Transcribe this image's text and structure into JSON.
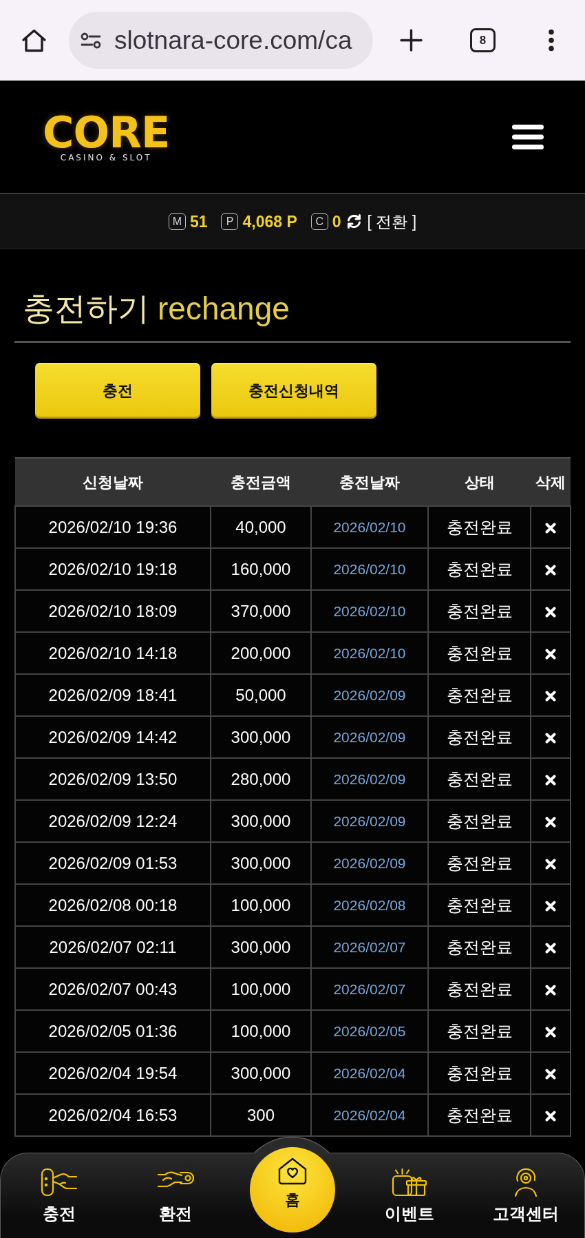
{
  "browser": {
    "url": "slotnara-core.com/ca",
    "tab_count": "8"
  },
  "header": {
    "logo": {
      "wordmark": "CORE",
      "tagline": "CASINO & SLOT"
    }
  },
  "balance": {
    "items": [
      {
        "mark": "M",
        "value": "51"
      },
      {
        "mark": "P",
        "value": "4,068 P"
      },
      {
        "mark": "C",
        "value": "0"
      }
    ],
    "convert_label": "[ 전환 ]"
  },
  "page": {
    "title": "충전하기",
    "subtitle": "rechange"
  },
  "actions": [
    {
      "label": "충전"
    },
    {
      "label": "충전신청내역"
    }
  ],
  "table": {
    "columns": [
      "신청날짜",
      "충전금액",
      "충전날짜",
      "상태",
      "삭제"
    ],
    "rows": [
      {
        "requested_at": "2026/02/10 19:36",
        "amount": "40,000",
        "charged_at": "2026/02/10",
        "status": "충전완료"
      },
      {
        "requested_at": "2026/02/10 19:18",
        "amount": "160,000",
        "charged_at": "2026/02/10",
        "status": "충전완료"
      },
      {
        "requested_at": "2026/02/10 18:09",
        "amount": "370,000",
        "charged_at": "2026/02/10",
        "status": "충전완료"
      },
      {
        "requested_at": "2026/02/10 14:18",
        "amount": "200,000",
        "charged_at": "2026/02/10",
        "status": "충전완료"
      },
      {
        "requested_at": "2026/02/09 18:41",
        "amount": "50,000",
        "charged_at": "2026/02/09",
        "status": "충전완료"
      },
      {
        "requested_at": "2026/02/09 14:42",
        "amount": "300,000",
        "charged_at": "2026/02/09",
        "status": "충전완료"
      },
      {
        "requested_at": "2026/02/09 13:50",
        "amount": "280,000",
        "charged_at": "2026/02/09",
        "status": "충전완료"
      },
      {
        "requested_at": "2026/02/09 12:24",
        "amount": "300,000",
        "charged_at": "2026/02/09",
        "status": "충전완료"
      },
      {
        "requested_at": "2026/02/09 01:53",
        "amount": "300,000",
        "charged_at": "2026/02/09",
        "status": "충전완료"
      },
      {
        "requested_at": "2026/02/08 00:18",
        "amount": "100,000",
        "charged_at": "2026/02/08",
        "status": "충전완료"
      },
      {
        "requested_at": "2026/02/07 02:11",
        "amount": "300,000",
        "charged_at": "2026/02/07",
        "status": "충전완료"
      },
      {
        "requested_at": "2026/02/07 00:43",
        "amount": "100,000",
        "charged_at": "2026/02/07",
        "status": "충전완료"
      },
      {
        "requested_at": "2026/02/05 01:36",
        "amount": "100,000",
        "charged_at": "2026/02/05",
        "status": "충전완료"
      },
      {
        "requested_at": "2026/02/04 19:54",
        "amount": "300,000",
        "charged_at": "2026/02/04",
        "status": "충전완료"
      },
      {
        "requested_at": "2026/02/04 16:53",
        "amount": "300",
        "charged_at": "2026/02/04",
        "status": "충전완료"
      }
    ]
  },
  "bottom_nav": [
    {
      "label": "충전",
      "kind": "tab"
    },
    {
      "label": "환전",
      "kind": "tab"
    },
    {
      "label": "홈",
      "kind": "home"
    },
    {
      "label": "이벤트",
      "kind": "tab"
    },
    {
      "label": "고객센터",
      "kind": "tab"
    }
  ]
}
